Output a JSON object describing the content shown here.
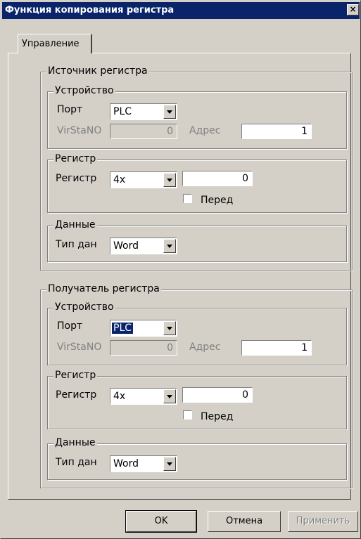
{
  "window": {
    "title": "Функция копирования регистра",
    "close_icon": "×"
  },
  "tabs": [
    {
      "label": "Управление"
    }
  ],
  "source": {
    "title": "Источник регистра",
    "device": {
      "title": "Устройство",
      "port_label": "Порт",
      "port_value": "PLC",
      "virstano_label": "VirStaNO",
      "virstano_value": "0",
      "address_label": "Адрес",
      "address_value": "1"
    },
    "register": {
      "title": "Регистр",
      "label": "Регистр",
      "type_value": "4x",
      "address_value": "0",
      "checkbox_label": "Перед",
      "checkbox_checked": false
    },
    "data": {
      "title": "Данные",
      "type_label": "Тип дан",
      "type_value": "Word"
    }
  },
  "destination": {
    "title": "Получатель регистра",
    "device": {
      "title": "Устройство",
      "port_label": "Порт",
      "port_value": "PLC",
      "virstano_label": "VirStaNO",
      "virstano_value": "0",
      "address_label": "Адрес",
      "address_value": "1"
    },
    "register": {
      "title": "Регистр",
      "label": "Регистр",
      "type_value": "4x",
      "address_value": "0",
      "checkbox_label": "Перед",
      "checkbox_checked": false
    },
    "data": {
      "title": "Данные",
      "type_label": "Тип дан",
      "type_value": "Word"
    }
  },
  "buttons": {
    "ok": "OK",
    "cancel": "Отмена",
    "apply": "Применить"
  },
  "colors": {
    "titlebar": "#0a246a",
    "face": "#d4d0c8",
    "selection": "#0a246a"
  }
}
